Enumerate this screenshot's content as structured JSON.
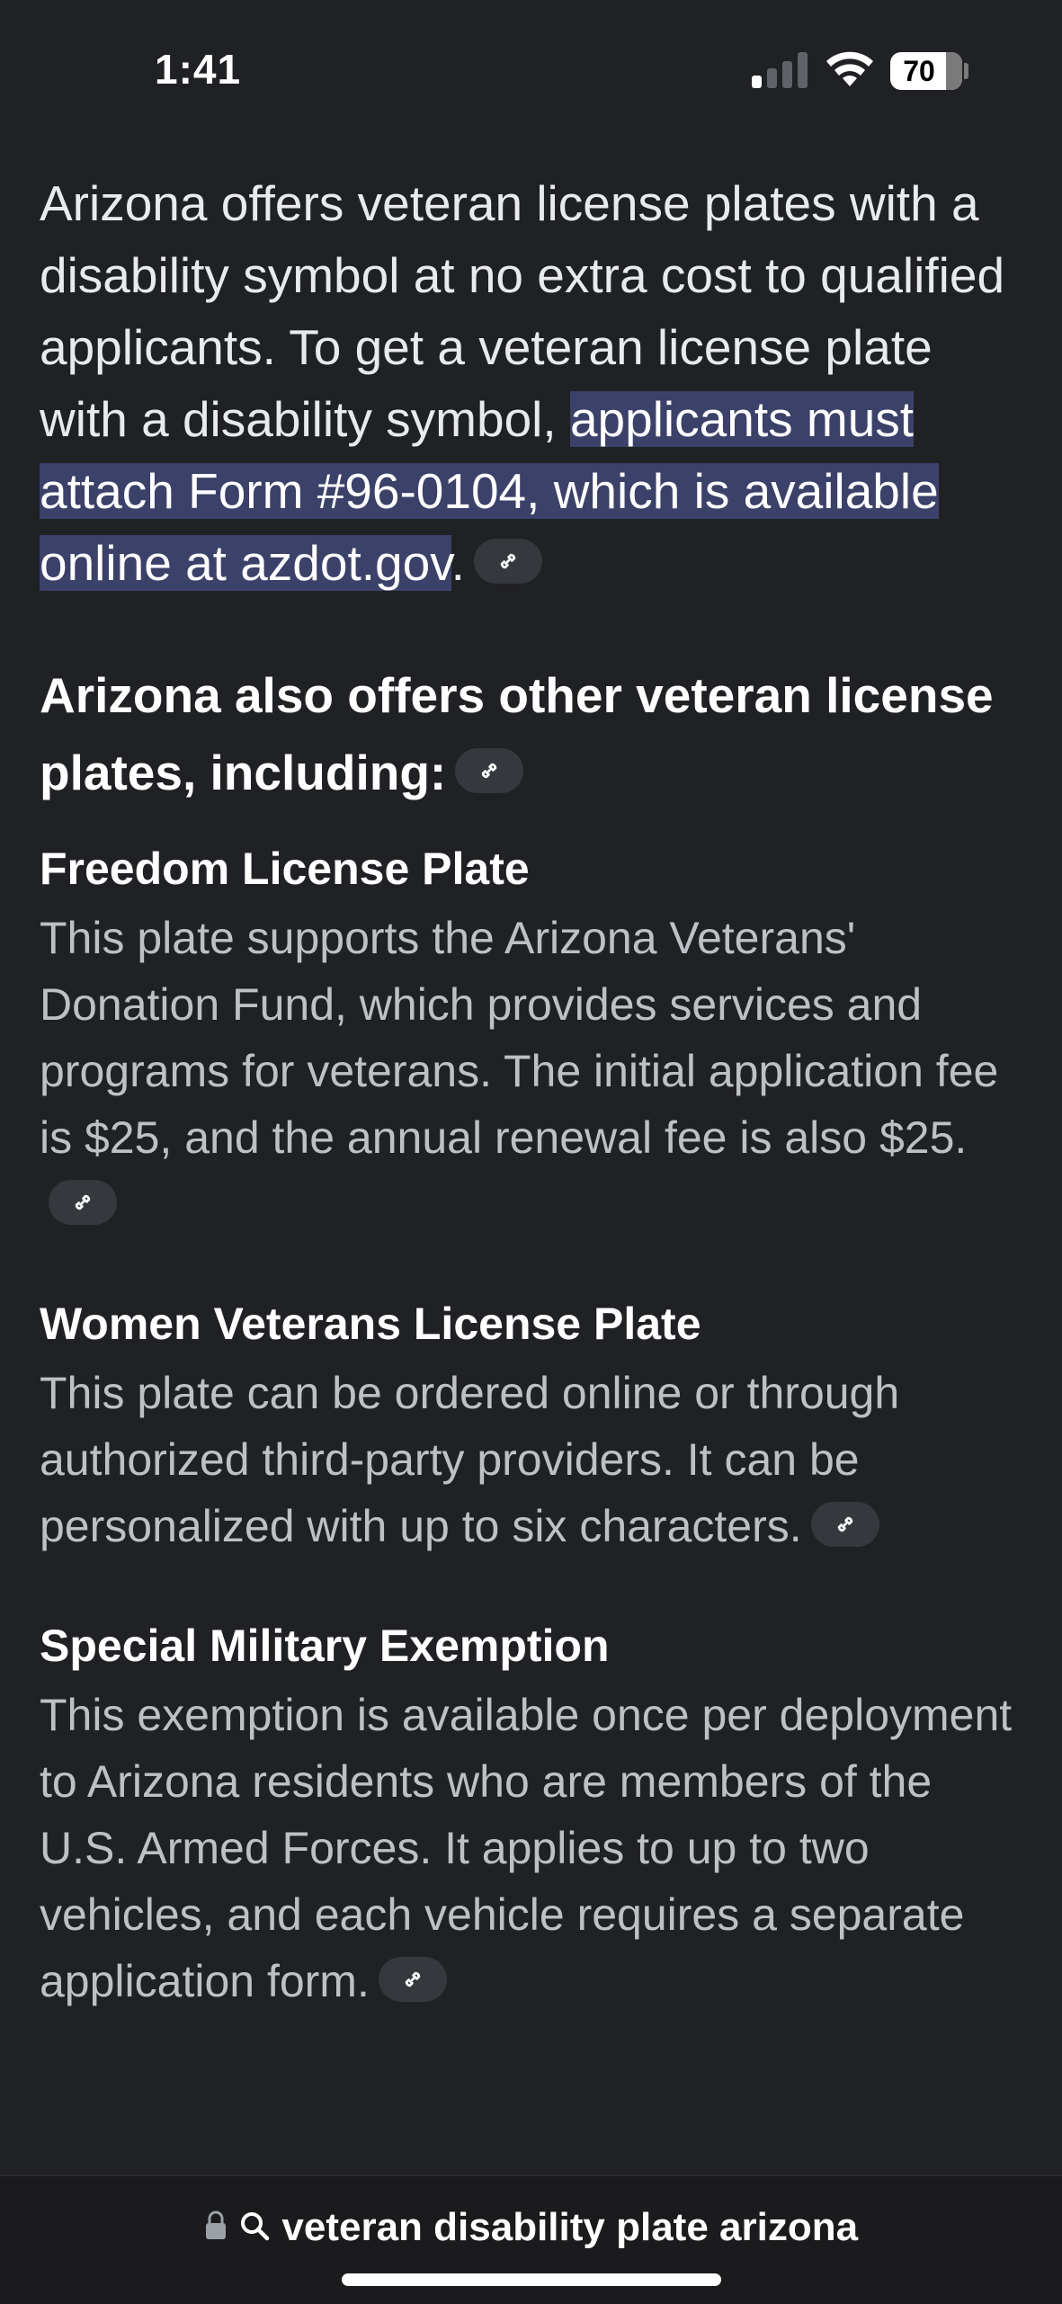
{
  "status_bar": {
    "time": "1:41",
    "battery": "70"
  },
  "article": {
    "intro_prefix": "Arizona offers veteran license plates with a disability symbol at no extra cost to qualified applicants. To get a veteran license plate with a disability symbol, ",
    "intro_highlight": "applicants must attach Form #96-0104, which is available online at azdot.gov",
    "intro_suffix": ".",
    "subheading": "Arizona also offers other veteran license plates, including:",
    "items": [
      {
        "title": "Freedom License Plate",
        "body": "This plate supports the Arizona Veterans' Donation Fund, which provides services and programs for veterans. The initial application fee is $25, and the annual renewal fee is also $25."
      },
      {
        "title": "Women Veterans License Plate",
        "body": "This plate can be ordered online or through authorized third-party providers. It can be personalized with up to six characters."
      },
      {
        "title": "Special Military Exemption",
        "body": "This exemption is available once per deployment to Arizona residents who are members of the U.S. Armed Forces. It applies to up to two vehicles, and each vehicle requires a separate application form."
      }
    ]
  },
  "url_bar": {
    "query": "veteran disability plate arizona"
  },
  "icons": {
    "link": "link-icon",
    "lock": "lock-icon",
    "search": "search-icon"
  },
  "colors": {
    "background": "#202124",
    "highlight": "#3b4168",
    "chip": "#35383d",
    "body_text": "#bdc1c6"
  }
}
